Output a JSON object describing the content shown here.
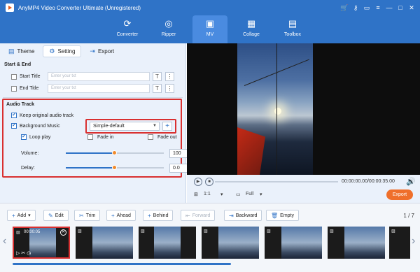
{
  "window": {
    "title": "AnyMP4 Video Converter Ultimate (Unregistered)"
  },
  "nav": [
    {
      "label": "Converter",
      "icon": "converter-icon",
      "glyph": "⟳"
    },
    {
      "label": "Ripper",
      "icon": "ripper-icon",
      "glyph": "◎"
    },
    {
      "label": "MV",
      "icon": "mv-icon",
      "glyph": "▣"
    },
    {
      "label": "Collage",
      "icon": "collage-icon",
      "glyph": "▦"
    },
    {
      "label": "Toolbox",
      "icon": "toolbox-icon",
      "glyph": "▤"
    }
  ],
  "tabs": [
    {
      "label": "Theme",
      "icon": "theme-icon"
    },
    {
      "label": "Setting",
      "icon": "setting-icon"
    },
    {
      "label": "Export",
      "icon": "export-icon"
    }
  ],
  "start_end": {
    "title": "Start & End",
    "start_label": "Start Title",
    "end_label": "End Title",
    "placeholder": "Enter your txt"
  },
  "audio": {
    "title": "Audio Track",
    "keep_original": "Keep original audio track",
    "background_music": "Background Music",
    "music_value": "Simple-default",
    "loop_play": "Loop play",
    "fade_in": "Fade in",
    "fade_out": "Fade out",
    "volume_label": "Volume:",
    "volume_value": "100",
    "volume_level": 0.5,
    "delay_label": "Delay:",
    "delay_value": "0.0",
    "delay_level": 0.5
  },
  "player": {
    "time": "00:00:00.00/00:00:35.00",
    "ratio": "1:1",
    "fit": "Full",
    "export": "Export"
  },
  "toolbar": {
    "add": "Add",
    "edit": "Edit",
    "trim": "Trim",
    "ahead": "Ahead",
    "behind": "Behind",
    "forward": "Forward",
    "backward": "Backward",
    "empty": "Empty",
    "page": "1 / 7"
  },
  "timeline": {
    "first_clip_duration": "00:00:05"
  },
  "colors": {
    "brand": "#2f73c7",
    "accent": "#ef6f2b",
    "highlight": "#d93030"
  }
}
